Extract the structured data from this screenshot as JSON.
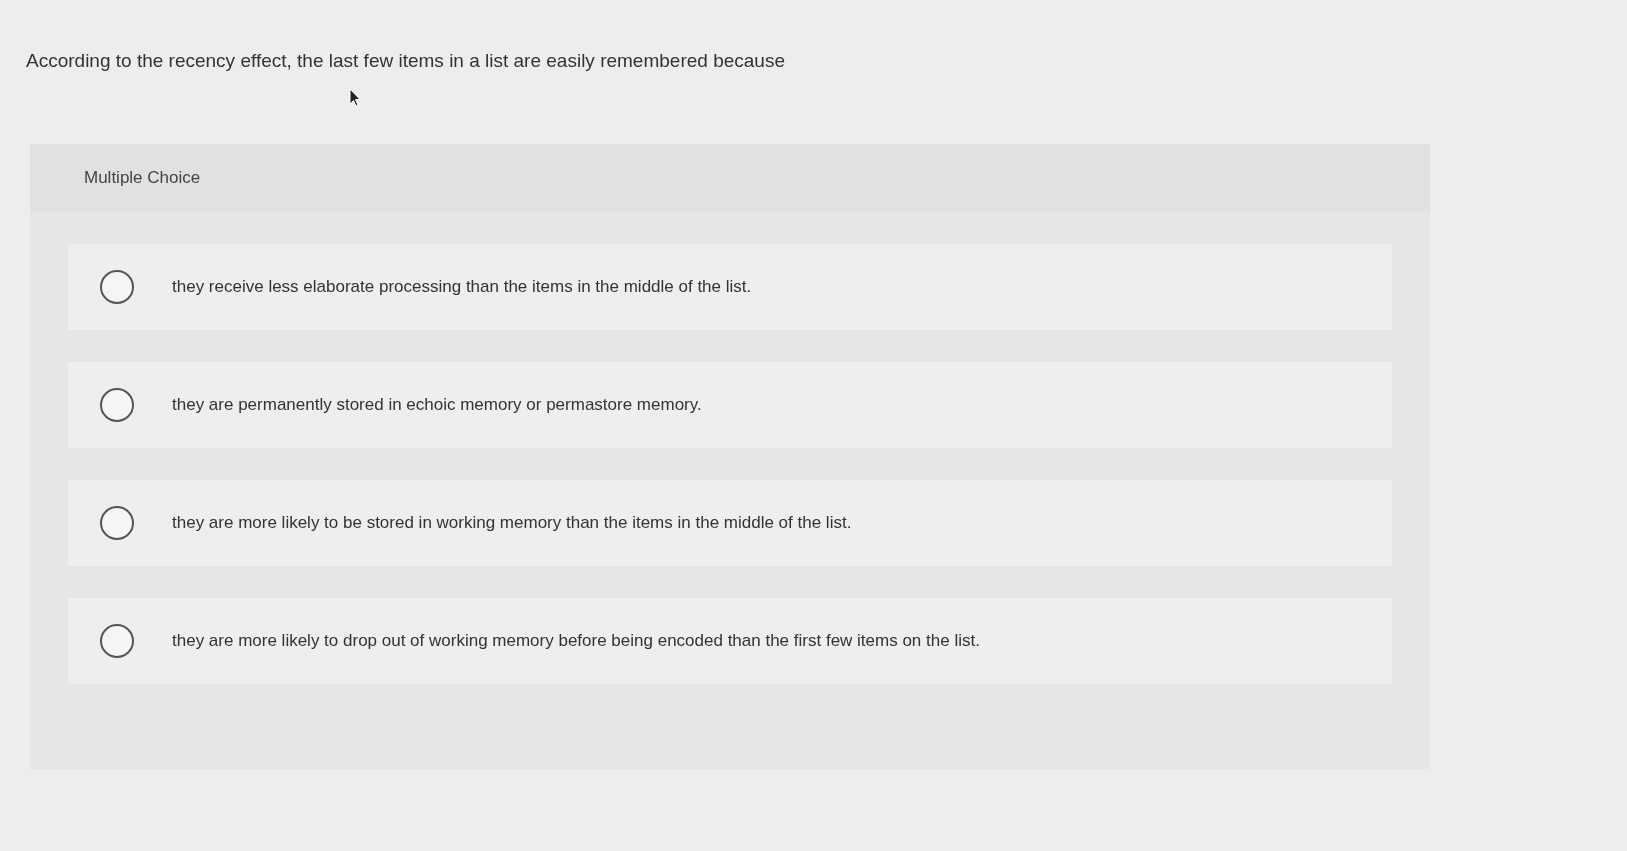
{
  "question": {
    "text": "According to the recency effect, the last few items in a list are easily remembered because"
  },
  "answer_panel": {
    "heading": "Multiple Choice",
    "choices": [
      {
        "label": "they receive less elaborate processing than the items in the middle of the list.",
        "selected": false
      },
      {
        "label": "they are permanently stored in echoic memory or permastore memory.",
        "selected": false
      },
      {
        "label": "they are more likely to be stored in working memory than the items in the middle of the list.",
        "selected": false
      },
      {
        "label": "they are more likely to drop out of working memory before being encoded than the first few items on the list.",
        "selected": false
      }
    ]
  }
}
